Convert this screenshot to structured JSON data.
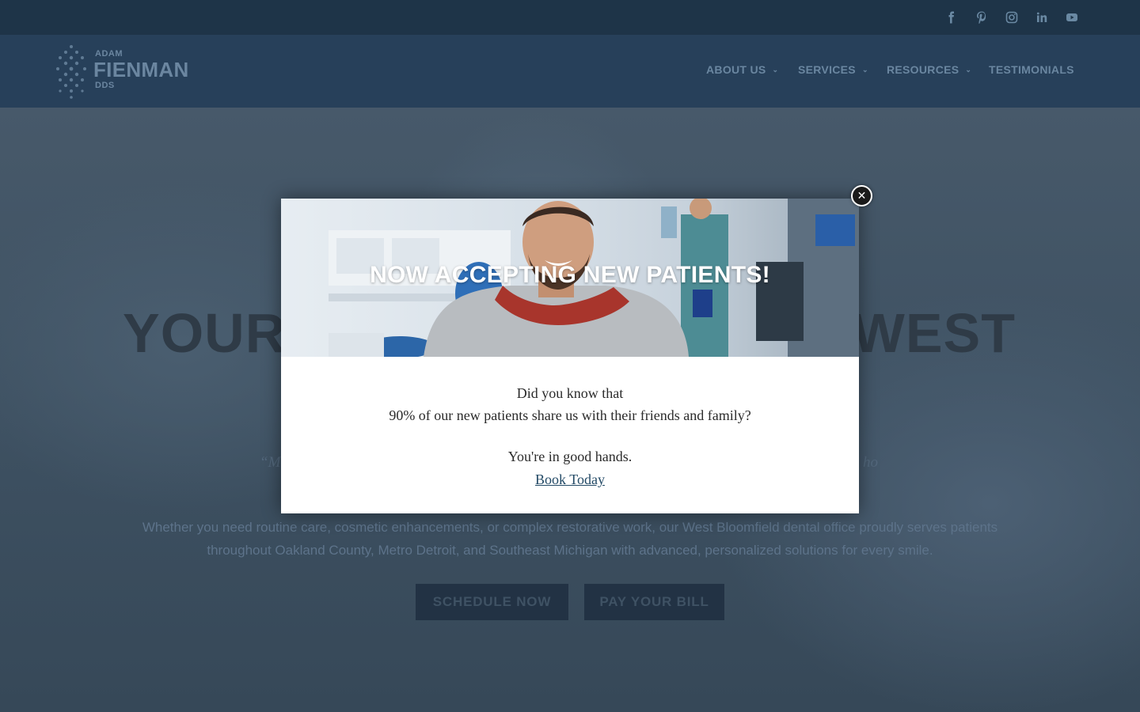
{
  "social": [
    {
      "name": "facebook-icon"
    },
    {
      "name": "pinterest-icon"
    },
    {
      "name": "instagram-icon"
    },
    {
      "name": "linkedin-icon"
    },
    {
      "name": "youtube-icon"
    }
  ],
  "logo": {
    "top_text": "ADAM",
    "main_text": "FIENMAN",
    "bottom_text": "DDS"
  },
  "nav": {
    "about": "ABOUT US",
    "services": "SERVICES",
    "resources": "RESOURCES",
    "testimonials": "TESTIMONIALS"
  },
  "hero": {
    "title_left": "YOUR",
    "title_right": "WEST",
    "quote_left": "“M",
    "quote_right": "ho",
    "paragraph": "Whether you need routine care, cosmetic enhancements, or complex restorative work, our West Bloomfield dental office proudly serves patients throughout Oakland County, Metro Detroit, and Southeast Michigan with advanced, personalized solutions for every smile.",
    "schedule_button": "SCHEDULE NOW",
    "pay_button": "PAY YOUR BILL"
  },
  "modal": {
    "title": "NOW ACCEPTING NEW PATIENTS!",
    "line1": "Did you know that",
    "line2": "90% of our new patients share us with their friends and family?",
    "line3": "You're in good hands.",
    "link": "Book Today",
    "close_glyph": "✕"
  },
  "colors": {
    "overlay_bg": "#3d4f5f",
    "topbar": "#1e3448",
    "header": "#27405a",
    "link": "#234a66"
  }
}
